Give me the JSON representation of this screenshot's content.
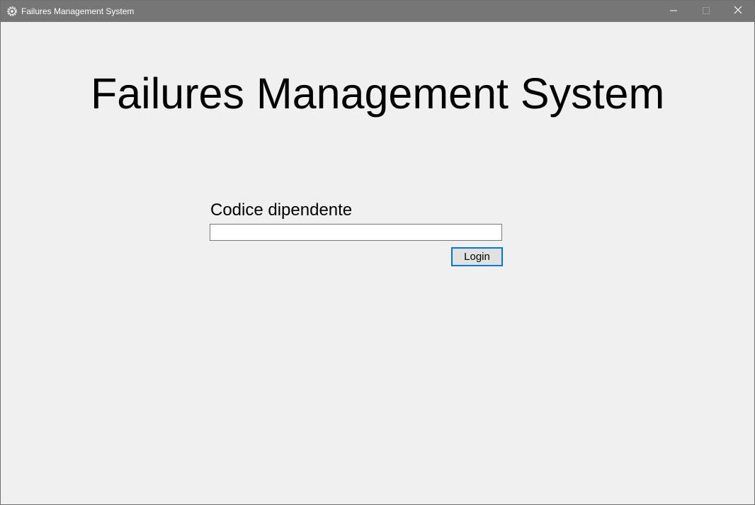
{
  "window": {
    "title": "Failures Management System",
    "icon": "gear-icon",
    "controls": {
      "minimize": "minimize-icon",
      "maximize": "maximize-icon",
      "close": "close-icon"
    }
  },
  "main": {
    "heading": "Failures Management System",
    "employee_code": {
      "label": "Codice dipendente",
      "value": "",
      "placeholder": ""
    },
    "login_button": "Login"
  },
  "colors": {
    "titlebar": "#767676",
    "window_background": "#f0f0f0",
    "button_focus_border": "#0078d7"
  }
}
